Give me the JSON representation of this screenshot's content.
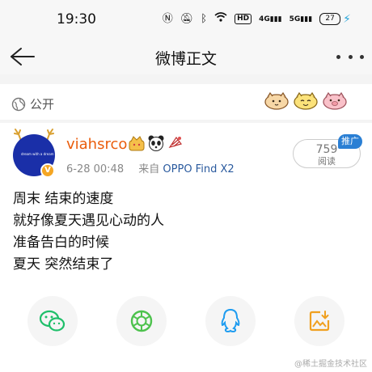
{
  "status_bar": {
    "time": "19:30",
    "signal_labels": [
      "HD",
      "4G",
      "5G"
    ],
    "battery": "27"
  },
  "nav": {
    "title": "微博正文"
  },
  "post_meta": {
    "visibility": "公开"
  },
  "author": {
    "username": "viahsrco",
    "avatar_text": "dream with a dream with",
    "date": "6-28 00:48",
    "source_prefix": "来自",
    "source": "OPPO Find X2"
  },
  "stats": {
    "views": "759",
    "views_label": "阅读",
    "promo_label": "推广"
  },
  "post": {
    "lines": [
      "周末 结束的速度",
      "就好像夏天遇见心动的人",
      "准备告白的时候",
      "夏天 突然结束了"
    ]
  },
  "share": {
    "items": [
      {
        "icon": "wechat-icon",
        "color": "#1fbf6a"
      },
      {
        "icon": "moments-icon",
        "color": "#4dc24d"
      },
      {
        "icon": "qq-icon",
        "color": "#1e9cf0"
      },
      {
        "icon": "save-image-icon",
        "color": "#f0a020"
      }
    ]
  },
  "watermark": "@稀土掘金技术社区",
  "colors": {
    "username": "#ea5d0c",
    "link": "#2a5a9e",
    "avatar": "#1a2fa8",
    "verified": "#f5a623",
    "promo": "#2a7fd4"
  }
}
